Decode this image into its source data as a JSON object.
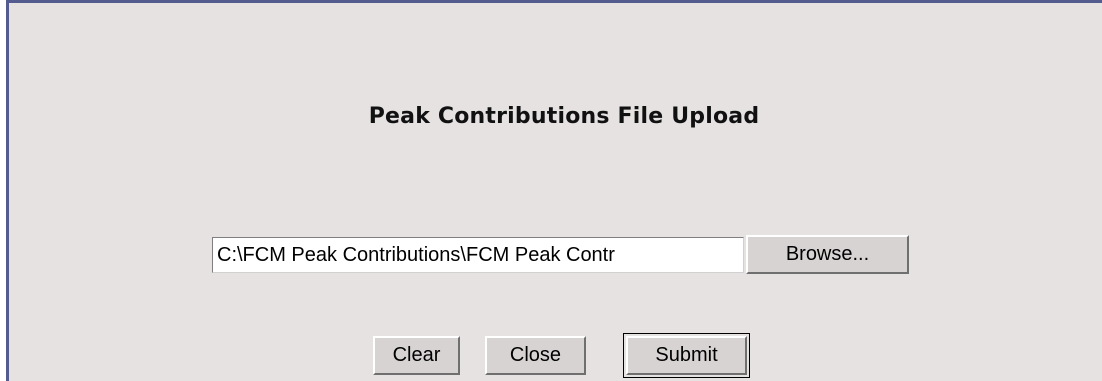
{
  "dialog": {
    "title": "Peak Contributions File Upload"
  },
  "file_upload": {
    "value": "C:\\FCM Peak Contributions\\FCM Peak Contr",
    "browse_label": "Browse..."
  },
  "actions": {
    "clear_label": "Clear",
    "close_label": "Close",
    "submit_label": "Submit"
  },
  "colors": {
    "panel_background": "#e6e2e2",
    "panel_border": "#545b8e",
    "button_face": "#d7d3d3"
  }
}
